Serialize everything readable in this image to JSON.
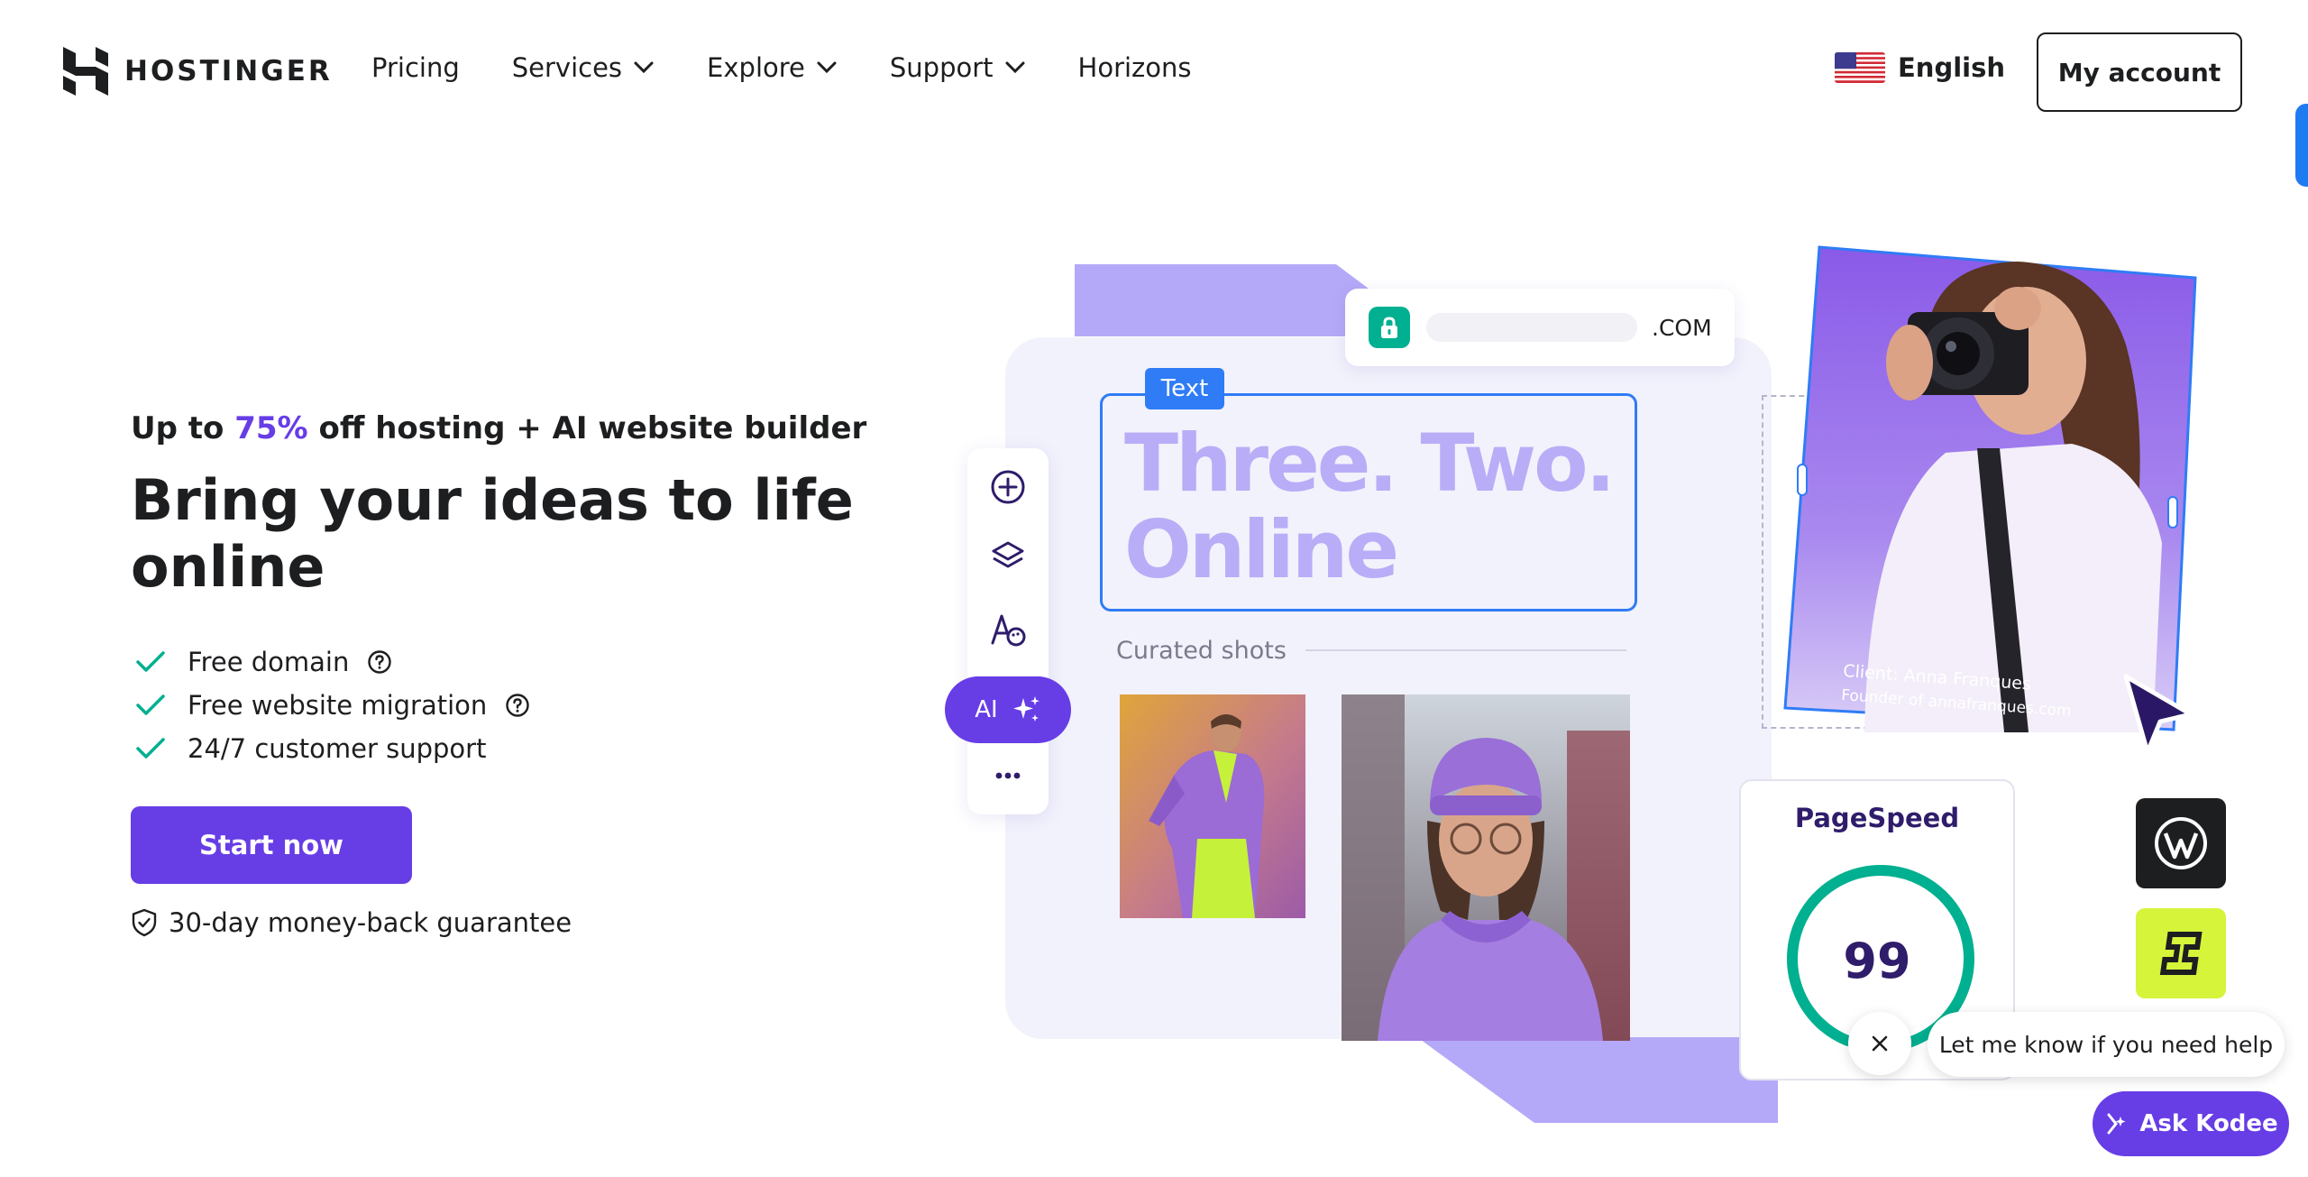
{
  "brand": {
    "name": "HOSTINGER"
  },
  "nav": {
    "items": [
      {
        "label": "Pricing",
        "dropdown": false
      },
      {
        "label": "Services",
        "dropdown": true
      },
      {
        "label": "Explore",
        "dropdown": true
      },
      {
        "label": "Support",
        "dropdown": true
      },
      {
        "label": "Horizons",
        "dropdown": false
      }
    ],
    "language": "English",
    "account_label": "My account"
  },
  "hero": {
    "promo_prefix": "Up to ",
    "promo_accent": "75%",
    "promo_suffix": " off hosting + AI website builder",
    "title": "Bring your ideas to life online",
    "features": [
      {
        "label": "Free domain",
        "has_help": true
      },
      {
        "label": "Free website migration",
        "has_help": true
      },
      {
        "label": "24/7 customer support",
        "has_help": false
      }
    ],
    "cta_label": "Start now",
    "guarantee": "30-day money-back guarantee"
  },
  "illustration": {
    "url_tld": ".COM",
    "text_tag": "Text",
    "headline_line1": "Three. Two.",
    "headline_line2": "Online",
    "curated_label": "Curated shots",
    "ai_label": "AI",
    "client_name": "Client: Anna Franques",
    "client_role": "Founder of annafranques.com",
    "pagespeed_title": "PageSpeed",
    "pagespeed_score": "99"
  },
  "chat": {
    "message": "Let me know if you need help",
    "button_label": "Ask Kodee"
  },
  "colors": {
    "accent": "#673de6",
    "success": "#00b090",
    "selection": "#2f7cf6"
  }
}
